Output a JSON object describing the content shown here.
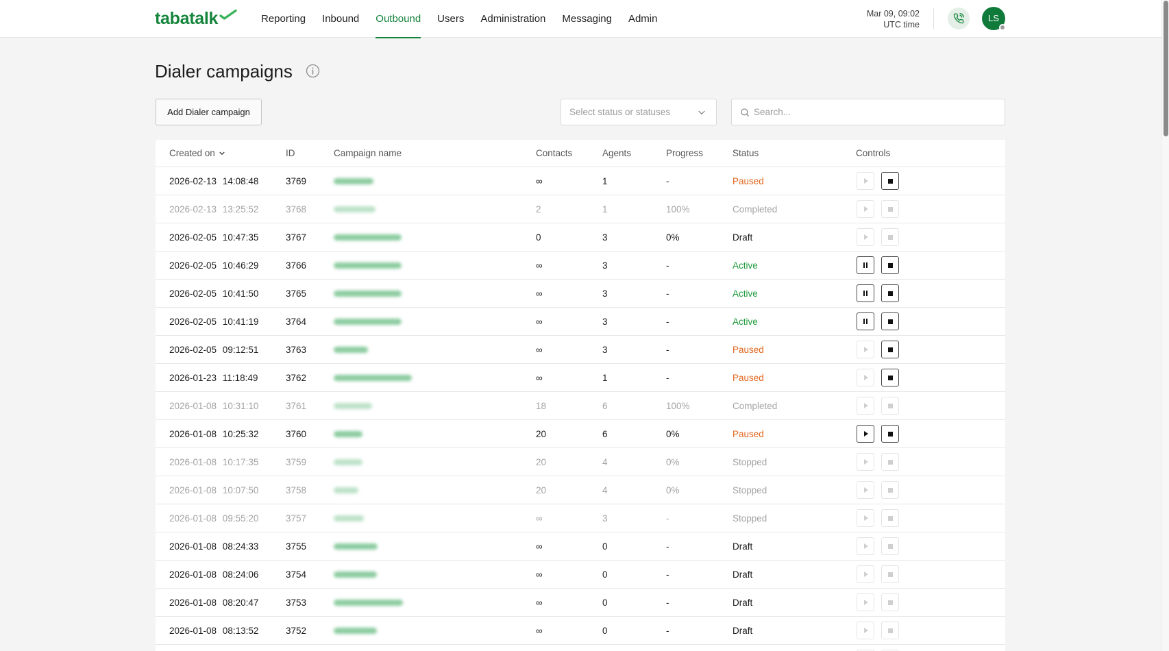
{
  "app": {
    "logo_text": "tabatalk"
  },
  "nav": {
    "items": [
      {
        "label": "Reporting"
      },
      {
        "label": "Inbound"
      },
      {
        "label": "Outbound",
        "active": true
      },
      {
        "label": "Users"
      },
      {
        "label": "Administration"
      },
      {
        "label": "Messaging"
      },
      {
        "label": "Admin"
      }
    ]
  },
  "header": {
    "date": "Mar 09, 09:02",
    "timezone_label": "UTC time",
    "avatar_initials": "LS"
  },
  "page": {
    "title": "Dialer campaigns"
  },
  "toolbar": {
    "add_button_label": "Add Dialer campaign",
    "status_select_placeholder": "Select status or statuses",
    "search_placeholder": "Search..."
  },
  "table": {
    "columns": [
      "Created on",
      "ID",
      "Campaign name",
      "Contacts",
      "Agents",
      "Progress",
      "Status",
      "Controls"
    ],
    "sort": {
      "column": "Created on",
      "icon": "chevron-down-icon"
    },
    "rows": [
      {
        "created_on": "2026-02-13 14:08:48",
        "id": "3769",
        "contacts": "∞",
        "agents": "1",
        "progress": "-",
        "status": "Paused",
        "controls": {
          "primary": "play",
          "primary_enabled": false,
          "stop_enabled": true
        }
      },
      {
        "created_on": "2026-02-13 13:25:52",
        "id": "3768",
        "contacts": "2",
        "agents": "1",
        "progress": "100%",
        "status": "Completed",
        "controls": {
          "primary": "play",
          "primary_enabled": false,
          "stop_enabled": false
        }
      },
      {
        "created_on": "2026-02-05 10:47:35",
        "id": "3767",
        "contacts": "0",
        "agents": "3",
        "progress": "0%",
        "status": "Draft",
        "controls": {
          "primary": "play",
          "primary_enabled": false,
          "stop_enabled": false
        }
      },
      {
        "created_on": "2026-02-05 10:46:29",
        "id": "3766",
        "contacts": "∞",
        "agents": "3",
        "progress": "-",
        "status": "Active",
        "controls": {
          "primary": "pause",
          "primary_enabled": true,
          "stop_enabled": true
        }
      },
      {
        "created_on": "2026-02-05 10:41:50",
        "id": "3765",
        "contacts": "∞",
        "agents": "3",
        "progress": "-",
        "status": "Active",
        "controls": {
          "primary": "pause",
          "primary_enabled": true,
          "stop_enabled": true
        }
      },
      {
        "created_on": "2026-02-05 10:41:19",
        "id": "3764",
        "contacts": "∞",
        "agents": "3",
        "progress": "-",
        "status": "Active",
        "controls": {
          "primary": "pause",
          "primary_enabled": true,
          "stop_enabled": true
        }
      },
      {
        "created_on": "2026-02-05 09:12:51",
        "id": "3763",
        "contacts": "∞",
        "agents": "3",
        "progress": "-",
        "status": "Paused",
        "controls": {
          "primary": "play",
          "primary_enabled": false,
          "stop_enabled": true
        }
      },
      {
        "created_on": "2026-01-23 11:18:49",
        "id": "3762",
        "contacts": "∞",
        "agents": "1",
        "progress": "-",
        "status": "Paused",
        "controls": {
          "primary": "play",
          "primary_enabled": false,
          "stop_enabled": true
        }
      },
      {
        "created_on": "2026-01-08 10:31:10",
        "id": "3761",
        "contacts": "18",
        "agents": "6",
        "progress": "100%",
        "status": "Completed",
        "controls": {
          "primary": "play",
          "primary_enabled": false,
          "stop_enabled": false
        }
      },
      {
        "created_on": "2026-01-08 10:25:32",
        "id": "3760",
        "contacts": "20",
        "agents": "6",
        "progress": "0%",
        "status": "Paused",
        "controls": {
          "primary": "play",
          "primary_enabled": true,
          "stop_enabled": true
        }
      },
      {
        "created_on": "2026-01-08 10:17:35",
        "id": "3759",
        "contacts": "20",
        "agents": "4",
        "progress": "0%",
        "status": "Stopped",
        "controls": {
          "primary": "play",
          "primary_enabled": false,
          "stop_enabled": false
        }
      },
      {
        "created_on": "2026-01-08 10:07:50",
        "id": "3758",
        "contacts": "20",
        "agents": "4",
        "progress": "0%",
        "status": "Stopped",
        "controls": {
          "primary": "play",
          "primary_enabled": false,
          "stop_enabled": false
        }
      },
      {
        "created_on": "2026-01-08 09:55:20",
        "id": "3757",
        "contacts": "∞",
        "agents": "3",
        "progress": "-",
        "status": "Stopped",
        "controls": {
          "primary": "play",
          "primary_enabled": false,
          "stop_enabled": false
        }
      },
      {
        "created_on": "2026-01-08 08:24:33",
        "id": "3755",
        "contacts": "∞",
        "agents": "0",
        "progress": "-",
        "status": "Draft",
        "controls": {
          "primary": "play",
          "primary_enabled": false,
          "stop_enabled": false
        }
      },
      {
        "created_on": "2026-01-08 08:24:06",
        "id": "3754",
        "contacts": "∞",
        "agents": "0",
        "progress": "-",
        "status": "Draft",
        "controls": {
          "primary": "play",
          "primary_enabled": false,
          "stop_enabled": false
        }
      },
      {
        "created_on": "2026-01-08 08:20:47",
        "id": "3753",
        "contacts": "∞",
        "agents": "0",
        "progress": "-",
        "status": "Draft",
        "controls": {
          "primary": "play",
          "primary_enabled": false,
          "stop_enabled": false
        }
      },
      {
        "created_on": "2026-01-08 08:13:52",
        "id": "3752",
        "contacts": "∞",
        "agents": "0",
        "progress": "-",
        "status": "Draft",
        "controls": {
          "primary": "play",
          "primary_enabled": false,
          "stop_enabled": false
        }
      }
    ]
  },
  "colors": {
    "accent": "#15853c",
    "status_paused": "#e0661c",
    "status_active": "#1f9a3d",
    "status_draft": "#1b1b1b",
    "status_muted": "#a3a3a3"
  },
  "icons": {
    "logo_mark": "check-swoosh-icon",
    "phone": "phone-call-icon",
    "info": "info-icon",
    "search": "search-icon",
    "select": "chevron-down-icon"
  }
}
